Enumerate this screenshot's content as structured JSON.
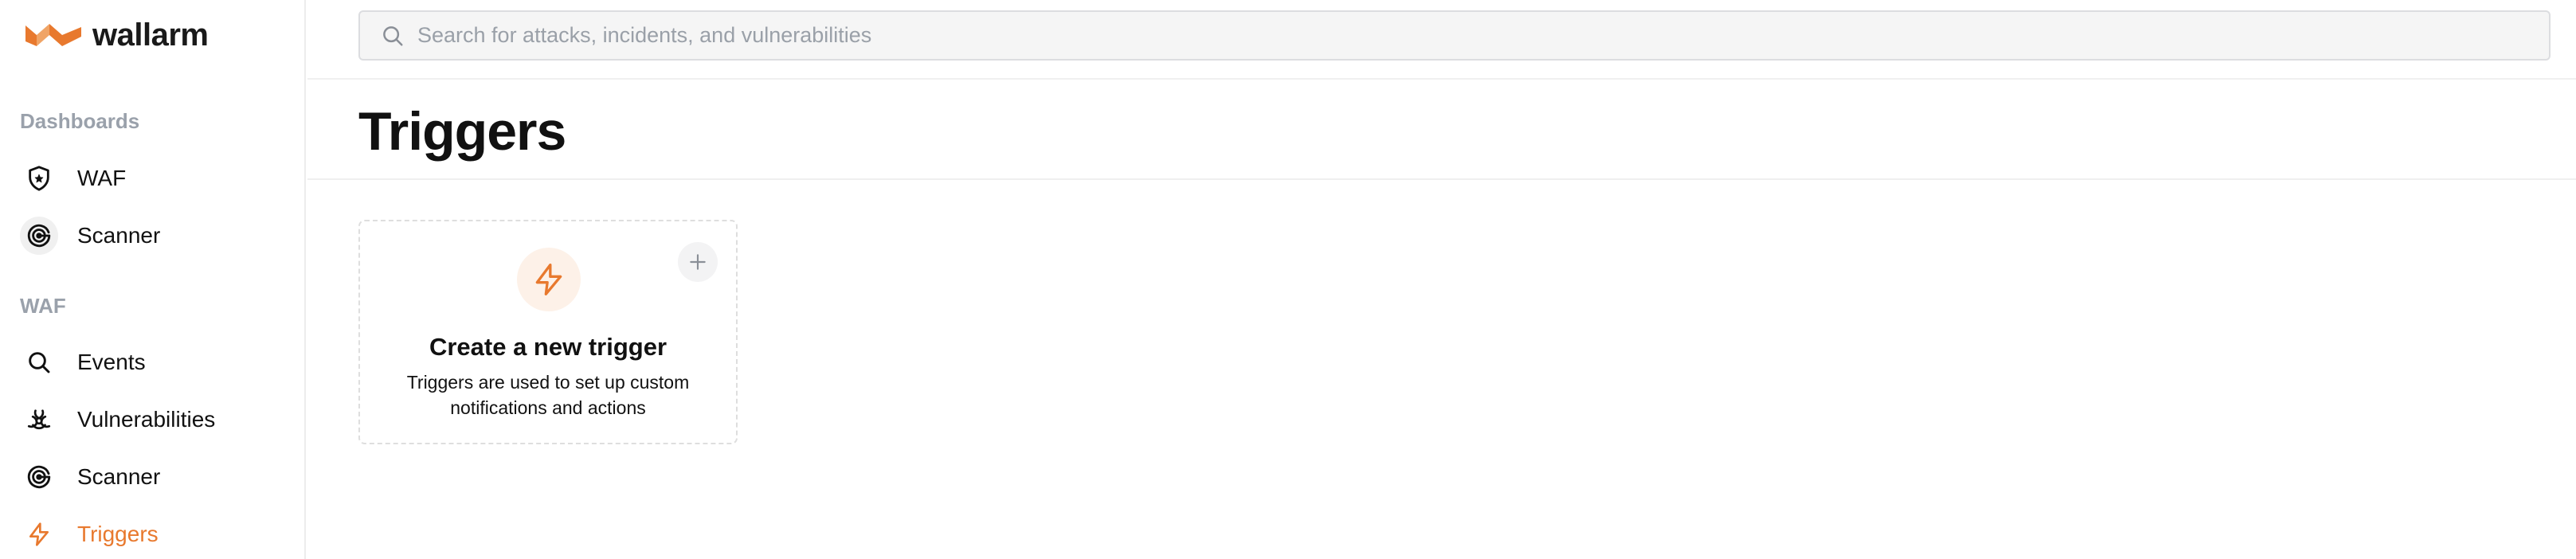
{
  "brand": {
    "name": "wallarm",
    "accent_color": "#e8792e"
  },
  "search": {
    "placeholder": "Search for attacks, incidents, and vulnerabilities",
    "value": ""
  },
  "sidebar": {
    "sections": [
      {
        "title": "Dashboards",
        "items": [
          {
            "label": "WAF",
            "icon": "shield-icon",
            "active": false
          },
          {
            "label": "Scanner",
            "icon": "scanner-icon",
            "active": false
          }
        ]
      },
      {
        "title": "WAF",
        "items": [
          {
            "label": "Events",
            "icon": "search-icon",
            "active": false
          },
          {
            "label": "Vulnerabilities",
            "icon": "biohazard-icon",
            "active": false
          },
          {
            "label": "Scanner",
            "icon": "scanner-icon",
            "active": false
          },
          {
            "label": "Triggers",
            "icon": "lightning-icon",
            "active": true
          }
        ]
      }
    ]
  },
  "page": {
    "title": "Triggers"
  },
  "card": {
    "title": "Create a new trigger",
    "description": "Triggers are used to set up custom notifications and actions",
    "icon": "lightning-icon",
    "add_icon": "plus-icon"
  }
}
